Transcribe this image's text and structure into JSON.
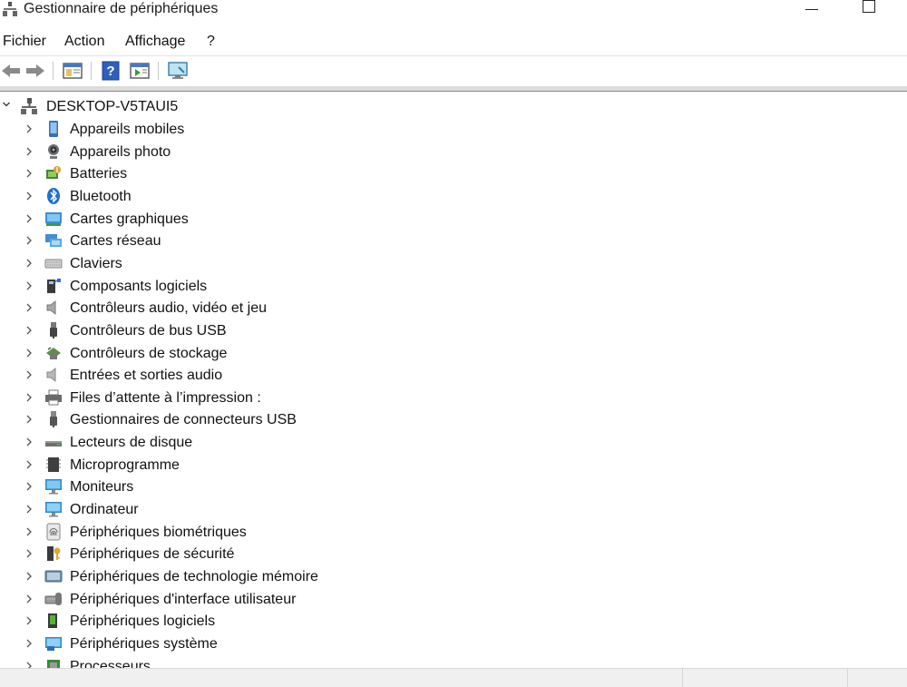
{
  "window": {
    "title": "Gestionnaire de périphériques"
  },
  "menu": [
    "Fichier",
    "Action",
    "Affichage",
    "?"
  ],
  "toolbar": {
    "buttons": [
      "back-icon",
      "forward-icon",
      "show-hide-console-tree-icon",
      "help-icon",
      "action-pane-icon",
      "monitor-icon"
    ]
  },
  "tree": {
    "root": "DESKTOP-V5TAUI5",
    "items": [
      {
        "label": "Appareils mobiles",
        "icon": "mobile-device-icon"
      },
      {
        "label": "Appareils photo",
        "icon": "camera-icon"
      },
      {
        "label": "Batteries",
        "icon": "battery-icon"
      },
      {
        "label": "Bluetooth",
        "icon": "bluetooth-icon"
      },
      {
        "label": "Cartes graphiques",
        "icon": "display-adapter-icon"
      },
      {
        "label": "Cartes réseau",
        "icon": "network-adapter-icon"
      },
      {
        "label": "Claviers",
        "icon": "keyboard-icon"
      },
      {
        "label": "Composants logiciels",
        "icon": "software-component-icon"
      },
      {
        "label": "Contrôleurs audio, vidéo et jeu",
        "icon": "speaker-icon"
      },
      {
        "label": "Contrôleurs de bus USB",
        "icon": "usb-icon"
      },
      {
        "label": "Contrôleurs de stockage",
        "icon": "storage-controller-icon"
      },
      {
        "label": "Entrées et sorties audio",
        "icon": "audio-io-icon"
      },
      {
        "label": "Files d’attente à l’impression :",
        "icon": "printer-icon"
      },
      {
        "label": "Gestionnaires de connecteurs USB",
        "icon": "usb-connector-icon"
      },
      {
        "label": "Lecteurs de disque",
        "icon": "disk-drive-icon"
      },
      {
        "label": "Microprogramme",
        "icon": "firmware-icon"
      },
      {
        "label": "Moniteurs",
        "icon": "monitor-icon"
      },
      {
        "label": "Ordinateur",
        "icon": "computer-icon"
      },
      {
        "label": "Périphériques biométriques",
        "icon": "fingerprint-icon"
      },
      {
        "label": "Périphériques de sécurité",
        "icon": "security-key-icon"
      },
      {
        "label": "Périphériques de technologie mémoire",
        "icon": "memory-icon"
      },
      {
        "label": "Périphériques d'interface utilisateur",
        "icon": "hid-icon"
      },
      {
        "label": "Périphériques logiciels",
        "icon": "software-device-icon"
      },
      {
        "label": "Périphériques système",
        "icon": "system-device-icon"
      },
      {
        "label": "Processeurs",
        "icon": "processor-icon"
      }
    ]
  }
}
